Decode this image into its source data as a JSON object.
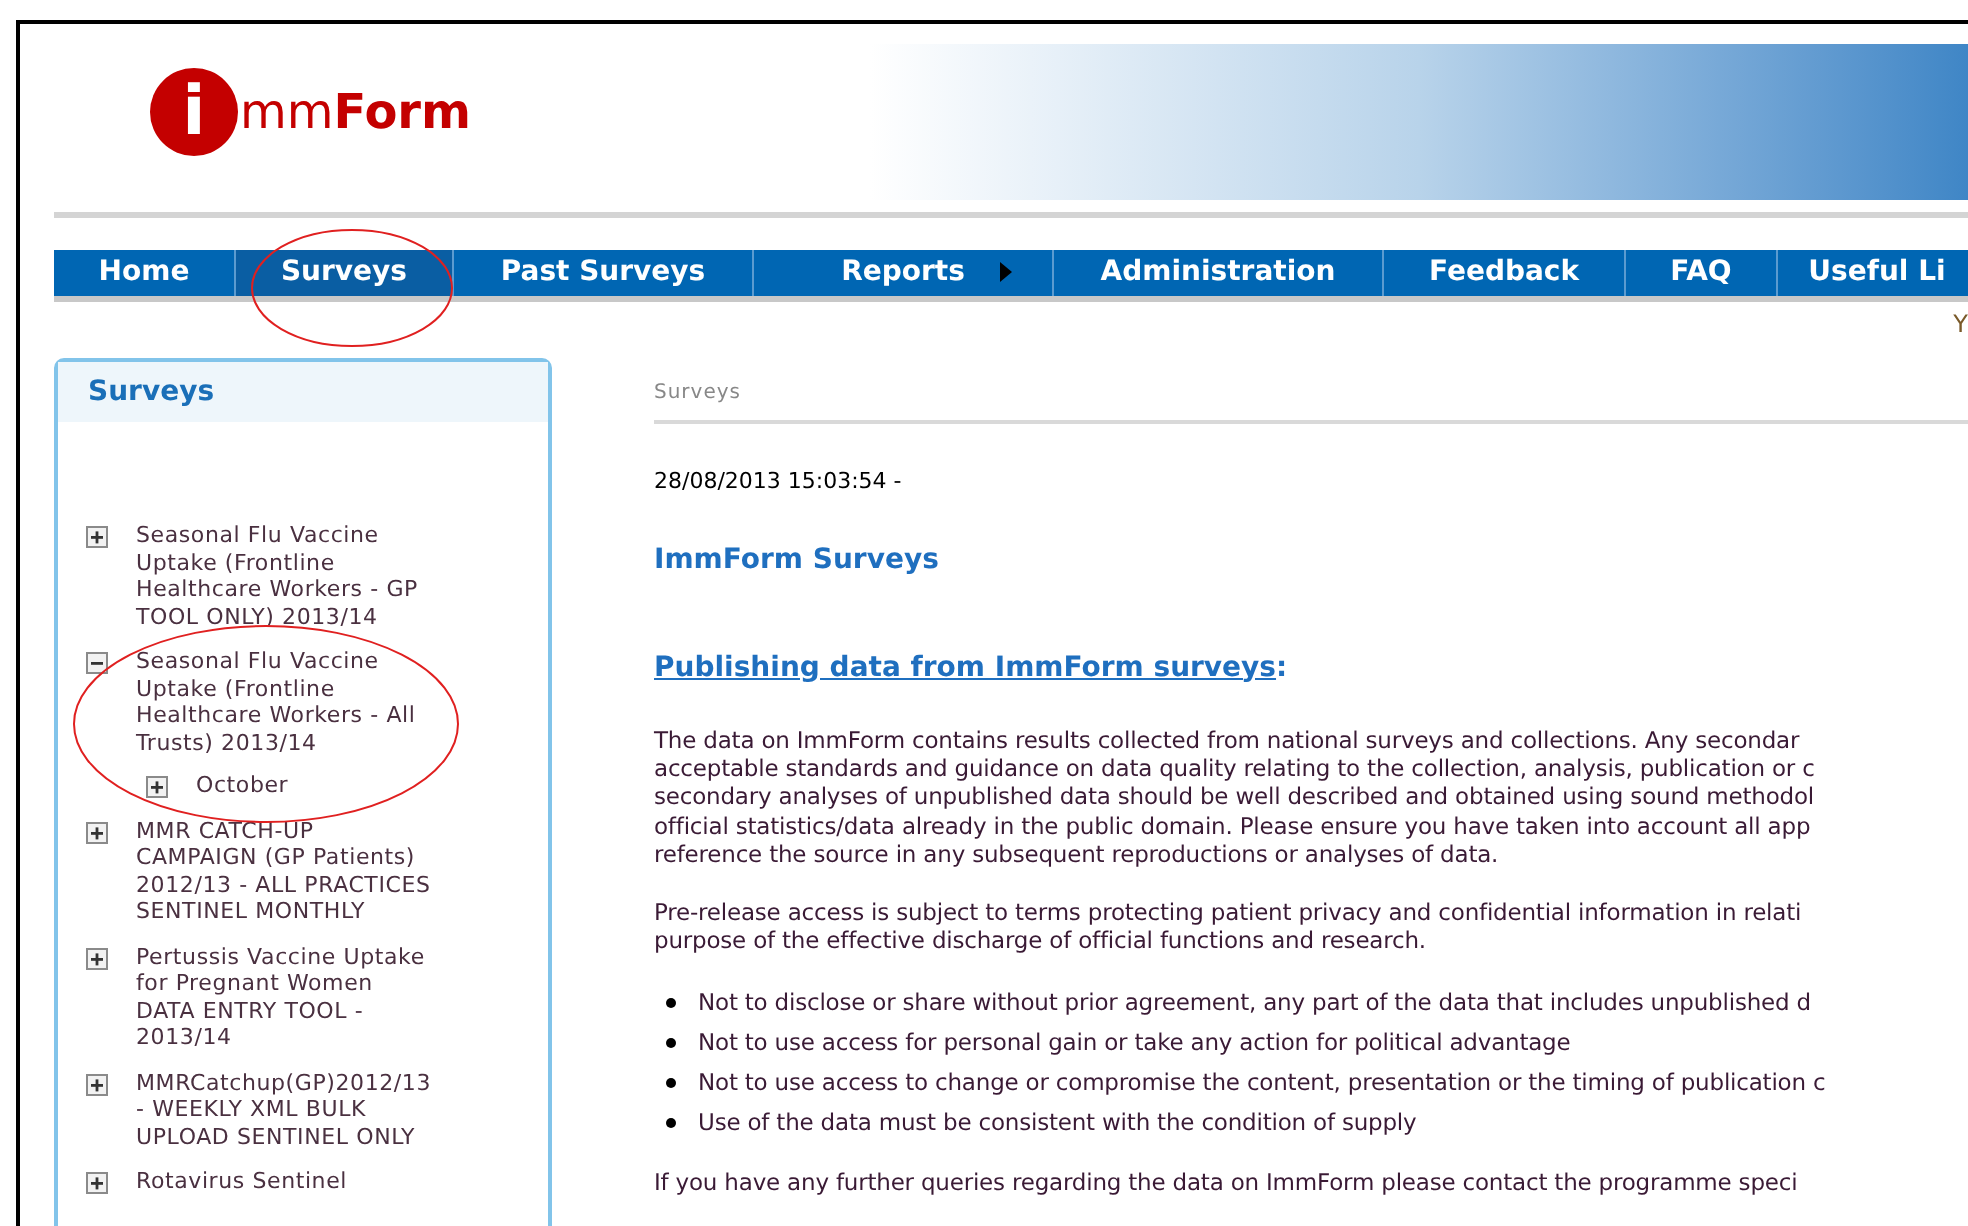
{
  "logo": {
    "letter": "i",
    "text_light": "mm",
    "text_bold": "Form"
  },
  "nav": [
    {
      "label": "Home",
      "selected": false,
      "submenu": false
    },
    {
      "label": "Surveys",
      "selected": true,
      "submenu": false
    },
    {
      "label": "Past Surveys",
      "selected": false,
      "submenu": false
    },
    {
      "label": "Reports",
      "selected": false,
      "submenu": true
    },
    {
      "label": "Administration",
      "selected": false,
      "submenu": false
    },
    {
      "label": "Feedback",
      "selected": false,
      "submenu": false
    },
    {
      "label": "FAQ",
      "selected": false,
      "submenu": false
    },
    {
      "label": "Useful Li",
      "selected": false,
      "submenu": false
    }
  ],
  "user_text": "Y",
  "sidebar": {
    "title": "Surveys",
    "items": [
      {
        "label": "Seasonal Flu Vaccine Uptake (Frontline Healthcare Workers - GP TOOL ONLY) 2013/14",
        "expanded": false
      },
      {
        "label": "Seasonal Flu Vaccine Uptake (Frontline Healthcare Workers - All Trusts) 2013/14",
        "expanded": true,
        "children": [
          {
            "label": "October",
            "expanded": false
          }
        ]
      },
      {
        "label": "MMR CATCH-UP CAMPAIGN (GP Patients) 2012/13 - ALL PRACTICES SENTINEL MONTHLY",
        "expanded": false
      },
      {
        "label": "Pertussis Vaccine Uptake for Pregnant Women DATA ENTRY TOOL - 2013/14",
        "expanded": false
      },
      {
        "label": "MMRCatchup(GP)2012/13 - WEEKLY XML BULK UPLOAD SENTINEL ONLY",
        "expanded": false
      },
      {
        "label": "Rotavirus Sentinel",
        "expanded": false
      }
    ]
  },
  "breadcrumb": "Surveys",
  "timestamp": "28/08/2013 15:03:54 -",
  "heading": "ImmForm Surveys",
  "section_link": "Publishing data from ImmForm surveys",
  "section_suffix": ":",
  "paragraphs": [
    [
      "The data on ImmForm contains results collected from national surveys and collections. Any secondar",
      "acceptable standards and guidance on data quality relating to the collection, analysis, publication or c",
      "secondary analyses of unpublished data should be well described and obtained using sound methodol",
      "official statistics/data already in the public domain. Please ensure you have taken into account all app",
      "reference the source in any subsequent reproductions or analyses of data."
    ],
    [
      "Pre-release access is subject to terms protecting patient privacy and confidential information in relati",
      "purpose of the effective discharge of official functions and research."
    ]
  ],
  "bullets": [
    "Not to disclose or share without prior agreement, any part of the data that includes unpublished d",
    "Not to use access for personal gain or take any action for political advantage",
    "Not to use access to change or compromise the content, presentation or the timing of publication c",
    "Use of the data must be consistent with the condition of supply"
  ],
  "footer_line": "If you have any further queries regarding the data on ImmForm please contact the programme speci"
}
